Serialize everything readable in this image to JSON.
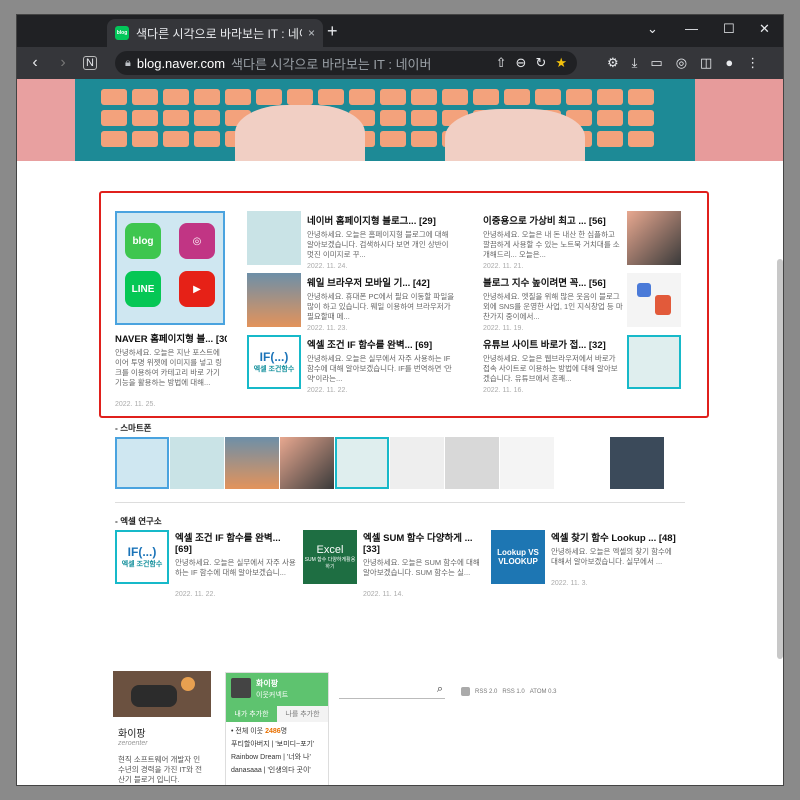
{
  "browser": {
    "tab_title": "색다른 시각으로 바라보는 IT : 네이버 블로그",
    "tab_close": "×",
    "new_tab": "+",
    "favicon_text": "blog",
    "url_host": "blog.naver.com",
    "url_path": "색다른 시각으로 바라보는 IT : 네이버 블로그",
    "window_controls": [
      "⌄",
      "—",
      "☐",
      "✕"
    ]
  },
  "featured": {
    "big": {
      "title": "NAVER 홈페이지형 블... [30]",
      "summary": "안녕하세요. 오늘은 지난 포스트에 이어 투명 위젯에 이미지를 넣고 링크를 이용하여 카테고리 바로 가기 기능을 활용하는 방법에 대해...",
      "date": "2022. 11. 25.",
      "thumb_labels": [
        "blog",
        "LINE"
      ]
    },
    "middle": [
      {
        "title": "네이버 홈페이지형 블로그... [29]",
        "summary": "안녕하세요. 오늘은 홈페이지형 블로그에 대해 알아보겠습니다. 검색하시다 보면 개인 상반이 멋진 이미지로 꾸...",
        "date": "2022. 11. 24."
      },
      {
        "title": "웨일 브라우저 모바일 기... [42]",
        "summary": "안녕하세요. 휴대폰 PC에서 필요 이동할 파일을 많이 하고 있습니다. 웨일 이용하여 브라우저가 필요할때 메...",
        "date": "2022. 11. 23."
      },
      {
        "title": "엑셀 조건 IF 함수를 완벽... [69]",
        "summary": "안녕하세요. 오늘은 실무에서 자주 사용하는 IF 함수에 대해 알아보겠습니다. IF를 번역하면 '만약'이라는...",
        "date": "2022. 11. 22.",
        "thumb_text": "IF(...)",
        "thumb_sub": "엑셀 조건함수"
      }
    ],
    "right": [
      {
        "title": "이중용으로 가상비 최고 ... [56]",
        "summary": "안녕하세요. 오늘은 내 돈 내산 한 심플하고 깔끔하게 사용할 수 있는 노트북 거치대를 소개해드리... 오늘은...",
        "date": "2022. 11. 21."
      },
      {
        "title": "블로그 지수 높이려면 꼭... [56]",
        "summary": "안녕하세요. 엣질을 위해 많은 웃음이 블로그 외에 SNS를 운영한 사업, 1인 지식창업 등 마찬가지 중이에서...",
        "date": "2022. 11. 19."
      },
      {
        "title": "유튜브 사이트 바로가 접... [32]",
        "summary": "안녕하세요. 오늘은 웹브라우저에서 바로가 접속 사이트로 이용하는 방법에 대해 알아보겠습니다. 유튜브에서 흔쾌...",
        "date": "2022. 11. 16."
      }
    ]
  },
  "sections": {
    "smartphone_label": "- 스마트폰",
    "excel_label": "- 엑셀 연구소"
  },
  "excel_posts": [
    {
      "title": "엑셀 조건 IF 함수를 완벽... [69]",
      "summary": "안녕하세요. 오늘은 실무에서 자주 사용하는 IF 함수에 대해 알아보겠습니...",
      "date": "2022. 11. 22.",
      "thumb_text": "IF(...)",
      "thumb_sub": "엑셀 조건함수"
    },
    {
      "title": "엑셀 SUM 함수 다양하게 ... [33]",
      "summary": "안녕하세요. 오늘은 SUM 함수에 대해 알아보겠습니다. SUM 함수는 실...",
      "date": "2022. 11. 14.",
      "thumb_text": "Excel",
      "thumb_sub": "SUM 함수 다양하게활용하기"
    },
    {
      "title": "엑셀 찾기 함수 Lookup ... [48]",
      "summary": "안녕하세요. 오늘은 엑셀의 찾기 함수에 대해서 알아보겠습니다. 실무에서 ...",
      "date": "2022. 11. 3.",
      "thumb_text": "Lookup VS VLOOKUP"
    }
  ],
  "profile": {
    "nickname": "화이팡",
    "user_id": "zeroenter",
    "intro": "현직 소프트웨어 개발자 인 수년의 경력을 가진 IT와 전산기 블로거 입니다."
  },
  "neighbor_widget": {
    "name": "화이팡",
    "sub": "이웃커넥트",
    "tab_mine": "내가 추가한",
    "tab_theirs": "나를 추가한",
    "total_label": "• 전체 이웃",
    "total_count": "2486",
    "total_suffix": "명",
    "items": [
      "푸티할아버지 | '보미디~포기'",
      "Rainbow Dream | '너와 나'",
      "danasaaa | '인생의다 곳이'"
    ]
  },
  "search": {
    "placeholder": ""
  },
  "rss_links": [
    "RSS 2.0",
    "RSS 1.0",
    "ATOM 0.3"
  ],
  "colors": {
    "highlight_box": "#e0201c",
    "accent_green": "#5ec36f",
    "teal": "#17b9c9"
  }
}
